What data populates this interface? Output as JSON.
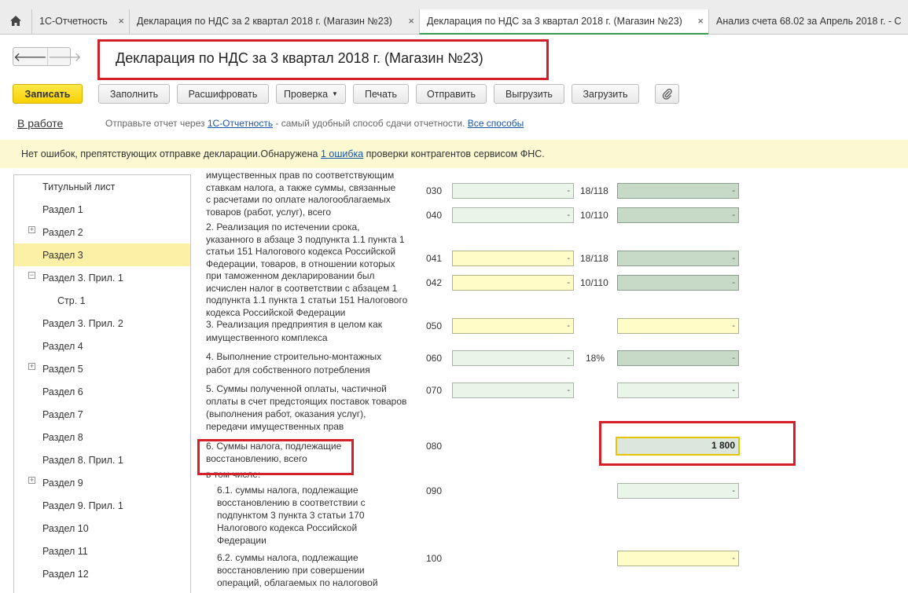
{
  "tabs": [
    {
      "label": "1С-Отчетность",
      "close": "×"
    },
    {
      "label": "Декларация по НДС за 2 квартал 2018 г. (Магазин №23)",
      "close": "×"
    },
    {
      "label": "Декларация по НДС за 3 квартал 2018 г. (Магазин №23)",
      "close": "×"
    },
    {
      "label": "Анализ счета 68.02 за Апрель 2018 г. - С",
      "close": ""
    }
  ],
  "header": {
    "title": "Декларация по НДС за 3 квартал 2018 г. (Магазин №23)",
    "back": "🡐",
    "forward": "🡒"
  },
  "toolbar": {
    "save": "Записать",
    "fill": "Заполнить",
    "decode": "Расшифровать",
    "check": "Проверка",
    "print": "Печать",
    "send": "Отправить",
    "export": "Выгрузить",
    "load": "Загрузить"
  },
  "status": {
    "state": "В работе",
    "hint_prefix": "Отправьте отчет через ",
    "hint_link": "1С-Отчетность",
    "hint_middle": " - самый удобный способ сдачи отчетности. ",
    "hint_all": "Все способы"
  },
  "banner": {
    "prefix": "Нет ошибок, препятствующих отправке декларации.Обнаружена ",
    "link": "1 ошибка",
    "suffix": " проверки контрагентов сервисом ФНС."
  },
  "sidebar": {
    "items": [
      {
        "label": "Титульный лист"
      },
      {
        "label": "Раздел 1"
      },
      {
        "label": "Раздел 2",
        "expander": "+"
      },
      {
        "label": "Раздел 3"
      },
      {
        "label": "Раздел 3. Прил. 1",
        "expander": "−"
      },
      {
        "label": "Стр. 1"
      },
      {
        "label": "Раздел 3. Прил. 2"
      },
      {
        "label": "Раздел 4"
      },
      {
        "label": "Раздел 5",
        "expander": "+"
      },
      {
        "label": "Раздел 6"
      },
      {
        "label": "Раздел 7"
      },
      {
        "label": "Раздел 8"
      },
      {
        "label": "Раздел 8. Прил. 1"
      },
      {
        "label": "Раздел 9",
        "expander": "+"
      },
      {
        "label": "Раздел 9. Прил. 1"
      },
      {
        "label": "Раздел 10"
      },
      {
        "label": "Раздел 11"
      },
      {
        "label": "Раздел 12"
      }
    ]
  },
  "form": {
    "labels": [
      "имущественных прав по соответствующим",
      "ставкам налога, а также суммы, связанные",
      "с расчетами по оплате налогооблагаемых",
      "товаров (работ, услуг), всего",
      "2. Реализация по истечении срока,",
      "указанного в абзаце 3 подпункта 1.1 пункта 1",
      "статьи 151 Налогового кодекса Российской",
      "Федерации, товаров, в отношении которых",
      "при таможенном декларировании был",
      "исчислен налог в соответствии с абзацем 1",
      "подпункта 1.1 пункта 1 статьи 151 Налогового",
      "кодекса Российской Федерации",
      "3. Реализация предприятия в целом как",
      "имущественного комплекса",
      "4. Выполнение строительно-монтажных",
      "работ для собственного потребления",
      "5. Суммы полученной оплаты, частичной",
      "оплаты в счет предстоящих поставок товаров",
      "(выполнения работ, оказания услуг),",
      "передачи имущественных прав",
      "6. Суммы налога, подлежащие",
      "восстановлению, всего",
      "в том числе:",
      "6.1. суммы налога, подлежащие",
      "восстановлению в соответствии с",
      "подпунктом 3 пункта 3 статьи 170",
      "Налогового кодекса Российской",
      "Федерации",
      "6.2. суммы налога, подлежащие",
      "восстановлению при совершении",
      "операций, облагаемых по налоговой"
    ],
    "rows": [
      {
        "code": "030",
        "rate": "18/118",
        "base": "-",
        "tax": "-"
      },
      {
        "code": "040",
        "rate": "10/110",
        "base": "-",
        "tax": "-"
      },
      {
        "code": "041",
        "rate": "18/118",
        "base": "-",
        "tax": "-"
      },
      {
        "code": "042",
        "rate": "10/110",
        "base": "-",
        "tax": "-"
      },
      {
        "code": "050",
        "rate": "",
        "base": "-",
        "tax": "-"
      },
      {
        "code": "060",
        "rate": "18%",
        "base": "-",
        "tax": "-"
      },
      {
        "code": "070",
        "rate": "",
        "base": "-",
        "tax": "-"
      },
      {
        "code": "080",
        "rate": "",
        "base": "",
        "tax": "1 800"
      },
      {
        "code": "090",
        "rate": "",
        "base": "",
        "tax": "-"
      },
      {
        "code": "100",
        "rate": "",
        "base": "",
        "tax": "-"
      }
    ]
  }
}
